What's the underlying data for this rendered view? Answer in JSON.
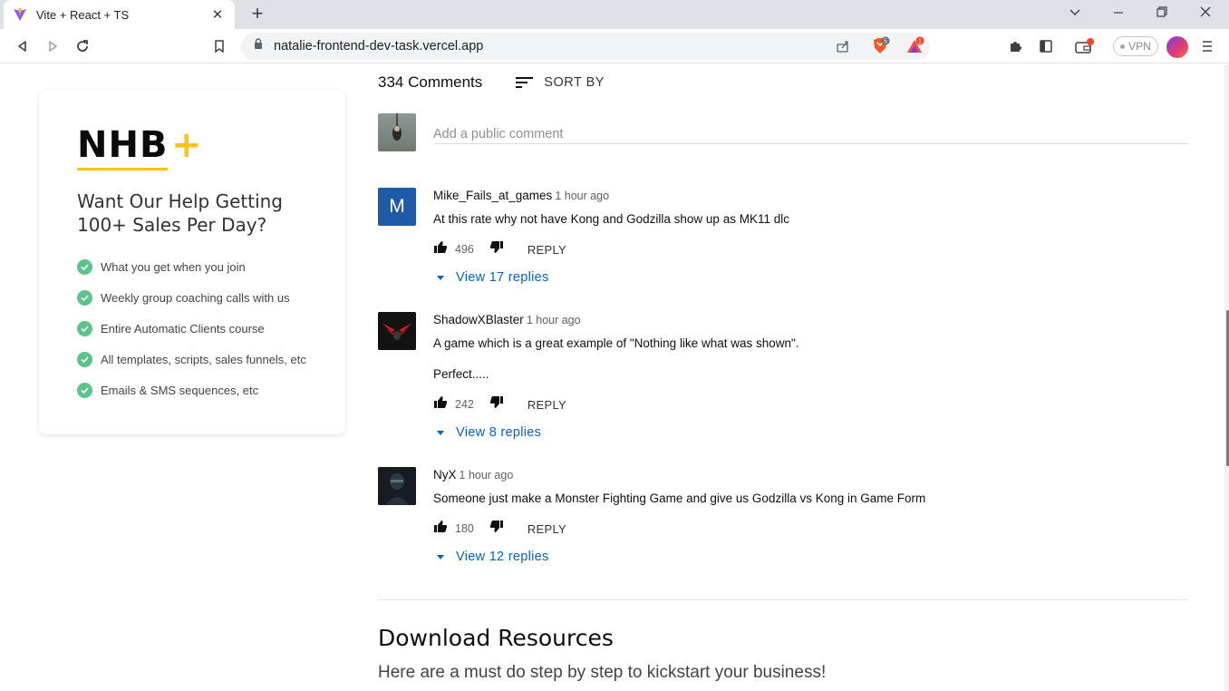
{
  "browser": {
    "tab_title": "Vite + React + TS",
    "url": "natalie-frontend-dev-task.vercel.app",
    "vpn_label": "VPN",
    "brave_badge": "5",
    "rewards_badge": "1"
  },
  "promo": {
    "logo_text": "NHB",
    "logo_plus": "+",
    "heading": "Want Our Help Getting 100+ Sales Per Day?",
    "benefits": [
      "What you get when you join",
      "Weekly group coaching calls with us",
      "Entire Automatic Clients course",
      "All templates, scripts, sales funnels, etc",
      "Emails & SMS sequences, etc"
    ]
  },
  "comments_section": {
    "count_label": "334 Comments",
    "sort_label": "SORT BY",
    "add_placeholder": "Add a public comment",
    "comments": [
      {
        "avatar_letter": "M",
        "author": "Mike_Fails_at_games",
        "time": "1 hour ago",
        "text": "At this rate why not have Kong and Godzilla show up as MK11 dlc",
        "likes": "496",
        "reply_label": "REPLY",
        "view_replies": "View 17 replies"
      },
      {
        "author": "ShadowXBlaster",
        "time": "1 hour ago",
        "text": "A game which is a great example of \"Nothing like what was shown\".",
        "text2": "Perfect.....",
        "likes": "242",
        "reply_label": "REPLY",
        "view_replies": "View 8 replies"
      },
      {
        "author": "NyX",
        "time": "1 hour ago",
        "text": "Someone just make a Monster Fighting Game and give us Godzilla vs Kong in Game Form",
        "likes": "180",
        "reply_label": "REPLY",
        "view_replies": "View 12 replies"
      }
    ]
  },
  "resources": {
    "title": "Download Resources",
    "subtitle": "Here are a must do step by step to kickstart your business!"
  },
  "colors": {
    "accent_yellow": "#f5c518",
    "check_green": "#5bc48a",
    "link_blue": "#065fd4",
    "avatar_blue": "#1f5aa6"
  }
}
